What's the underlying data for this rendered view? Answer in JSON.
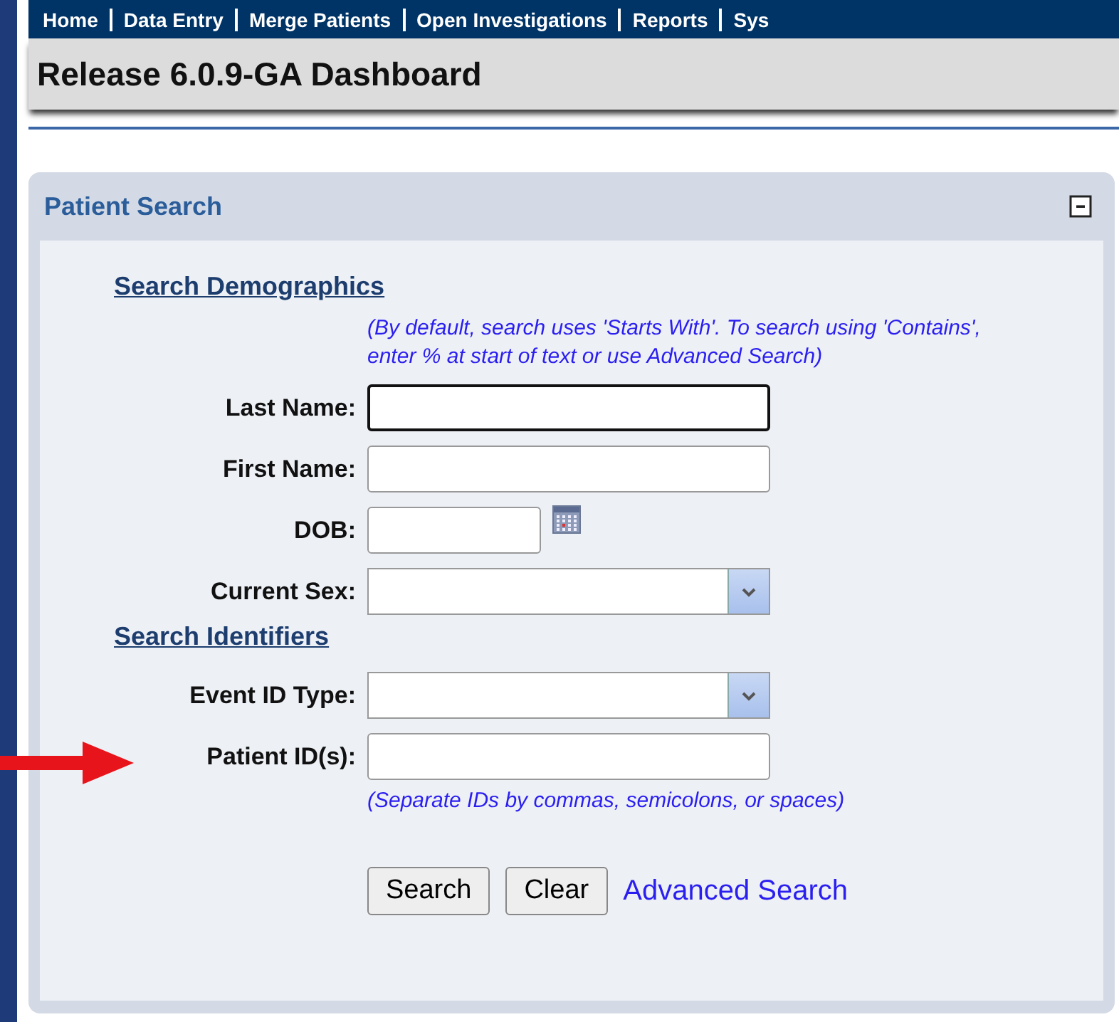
{
  "nav": [
    "Home",
    "Data Entry",
    "Merge Patients",
    "Open Investigations",
    "Reports",
    "Sys"
  ],
  "page_title": "Release 6.0.9-GA Dashboard",
  "panel": {
    "title": "Patient Search",
    "sections": [
      {
        "heading": "Search Demographics",
        "hint_top": "(By default, search uses 'Starts With'. To search using 'Contains', enter % at start of text or use Advanced Search)",
        "fields": [
          {
            "label": "Last Name:",
            "kind": "text",
            "focused": true
          },
          {
            "label": "First Name:",
            "kind": "text",
            "focused": false
          },
          {
            "label": "DOB:",
            "kind": "date",
            "focused": false
          },
          {
            "label": "Current Sex:",
            "kind": "select",
            "focused": false
          }
        ]
      },
      {
        "heading": "Search Identifiers",
        "fields": [
          {
            "label": "Event ID Type:",
            "kind": "select",
            "focused": false
          },
          {
            "label": "Patient ID(s):",
            "kind": "text",
            "focused": false,
            "hint": "(Separate IDs by commas, semicolons, or spaces)",
            "arrow": true
          }
        ]
      }
    ],
    "buttons": [
      "Search",
      "Clear"
    ],
    "link": "Advanced Search"
  }
}
